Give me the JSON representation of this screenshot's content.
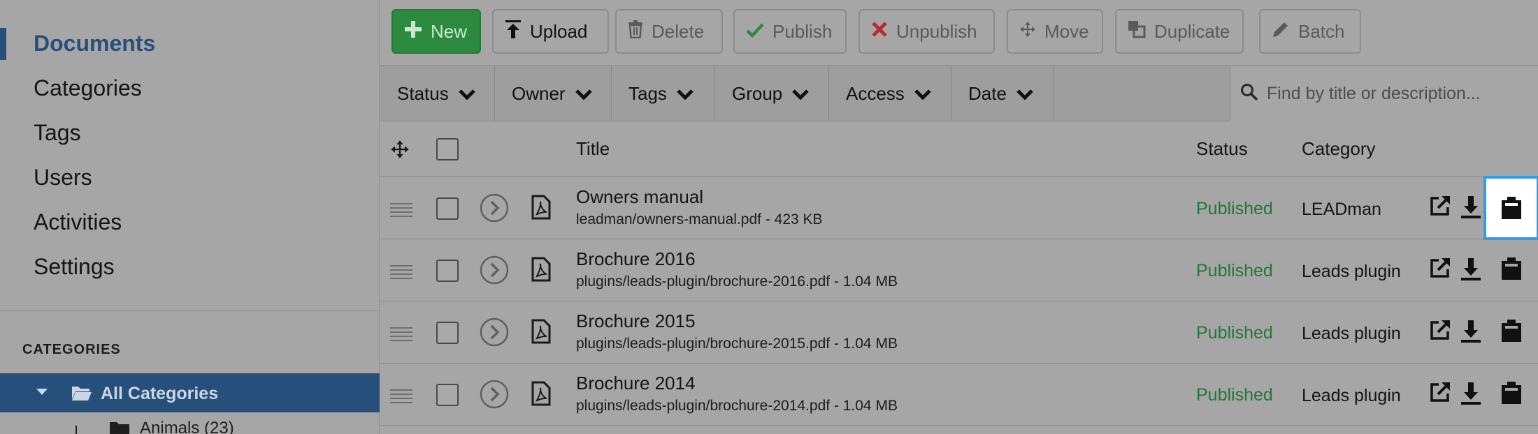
{
  "sidebar": {
    "nav": [
      {
        "label": "Documents",
        "active": true
      },
      {
        "label": "Categories",
        "active": false
      },
      {
        "label": "Tags",
        "active": false
      },
      {
        "label": "Users",
        "active": false
      },
      {
        "label": "Activities",
        "active": false
      },
      {
        "label": "Settings",
        "active": false
      }
    ],
    "categories_header": "CATEGORIES",
    "all_categories": "All Categories",
    "sub_category": "Animals (23)"
  },
  "toolbar": {
    "new": "New",
    "upload": "Upload",
    "delete": "Delete",
    "publish": "Publish",
    "unpublish": "Unpublish",
    "move": "Move",
    "duplicate": "Duplicate",
    "batch": "Batch"
  },
  "filters": {
    "status": "Status",
    "owner": "Owner",
    "tags": "Tags",
    "group": "Group",
    "access": "Access",
    "date": "Date",
    "search_placeholder": "Find by title or description..."
  },
  "table": {
    "headers": {
      "title": "Title",
      "status": "Status",
      "category": "Category"
    },
    "rows": [
      {
        "title": "Owners manual",
        "path": "leadman/owners-manual.pdf - 423 KB",
        "status": "Published",
        "category": "LEADman"
      },
      {
        "title": "Brochure 2016",
        "path": "plugins/leads-plugin/brochure-2016.pdf - 1.04 MB",
        "status": "Published",
        "category": "Leads plugin"
      },
      {
        "title": "Brochure 2015",
        "path": "plugins/leads-plugin/brochure-2015.pdf - 1.04 MB",
        "status": "Published",
        "category": "Leads plugin"
      },
      {
        "title": "Brochure 2014",
        "path": "plugins/leads-plugin/brochure-2014.pdf - 1.04 MB",
        "status": "Published",
        "category": "Leads plugin"
      }
    ]
  },
  "colors": {
    "accent": "#274f7c",
    "published": "#1f7a34",
    "new_button": "#2b8a3e",
    "focus": "#2d9cf0"
  }
}
